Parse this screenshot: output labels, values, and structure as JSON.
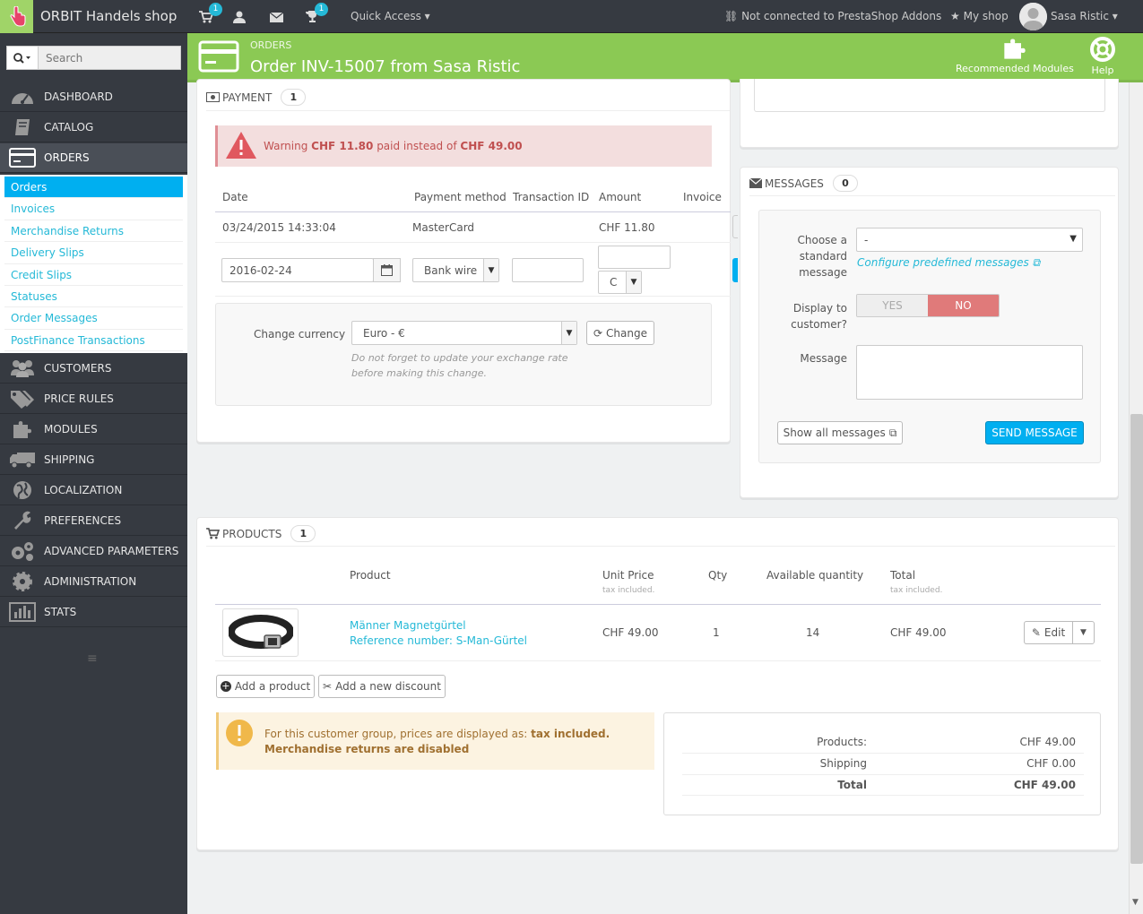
{
  "topbar": {
    "shop_name": "ORBIT Handels shop",
    "cart_badge": "1",
    "trophy_badge": "1",
    "quick_access": "Quick Access",
    "addons_status": "Not connected to PrestaShop Addons",
    "my_shop": "My shop",
    "user_name": "Sasa Ristic"
  },
  "sidebar": {
    "search_placeholder": "Search",
    "menu": [
      {
        "label": "DASHBOARD"
      },
      {
        "label": "CATALOG"
      },
      {
        "label": "ORDERS"
      },
      {
        "label": "CUSTOMERS"
      },
      {
        "label": "PRICE RULES"
      },
      {
        "label": "MODULES"
      },
      {
        "label": "SHIPPING"
      },
      {
        "label": "LOCALIZATION"
      },
      {
        "label": "PREFERENCES"
      },
      {
        "label": "ADVANCED PARAMETERS"
      },
      {
        "label": "ADMINISTRATION"
      },
      {
        "label": "STATS"
      }
    ],
    "submenu": [
      {
        "label": "Orders"
      },
      {
        "label": "Invoices"
      },
      {
        "label": "Merchandise Returns"
      },
      {
        "label": "Delivery Slips"
      },
      {
        "label": "Credit Slips"
      },
      {
        "label": "Statuses"
      },
      {
        "label": "Order Messages"
      },
      {
        "label": "PostFinance Transactions"
      }
    ]
  },
  "header": {
    "breadcrumb": "ORDERS",
    "title": "Order INV-15007 from Sasa Ristic",
    "recommended_modules": "Recommended Modules",
    "help": "Help"
  },
  "payment": {
    "heading": "PAYMENT",
    "count": "1",
    "warning_prefix": "Warning",
    "warning_paid": "CHF 11.80",
    "warning_mid": "paid instead of",
    "warning_expected": "CHF 49.00",
    "columns": {
      "date": "Date",
      "method": "Payment method",
      "transaction": "Transaction ID",
      "amount": "Amount",
      "invoice": "Invoice"
    },
    "row": {
      "date": "03/24/2015 14:33:04",
      "method": "MasterCard",
      "amount": "CHF 11.80"
    },
    "form": {
      "date_value": "2016-02-24",
      "method_value": "Bank wire",
      "currency_short": "C"
    },
    "currency": {
      "label": "Change currency",
      "value": "Euro - €",
      "button": "Change",
      "note": "Do not forget to update your exchange rate before making this change."
    }
  },
  "messages": {
    "heading": "MESSAGES",
    "count": "0",
    "choose_label_1": "Choose a",
    "choose_label_2": "standard",
    "choose_label_3": "message",
    "choose_value": "-",
    "configure_link": "Configure predefined messages",
    "display_label_1": "Display to",
    "display_label_2": "customer?",
    "yes": "YES",
    "no": "NO",
    "message_label": "Message",
    "show_all": "Show all messages",
    "send": "SEND MESSAGE"
  },
  "products": {
    "heading": "PRODUCTS",
    "count": "1",
    "columns": {
      "product": "Product",
      "unit_price": "Unit Price",
      "unit_price_sub": "tax included.",
      "qty": "Qty",
      "available": "Available quantity",
      "total": "Total",
      "total_sub": "tax included."
    },
    "row": {
      "name": "Männer Magnetgürtel",
      "reference": "Reference number: S-Man-Gürtel",
      "unit_price": "CHF 49.00",
      "qty": "1",
      "available": "14",
      "total": "CHF 49.00",
      "edit": "Edit"
    },
    "add_product": "Add a product",
    "add_discount": "Add a new discount",
    "notice_prefix": "For this customer group, prices are displayed as:",
    "notice_bold": "tax included.",
    "notice_returns": "Merchandise returns are disabled",
    "summary": {
      "products_label": "Products:",
      "products_value": "CHF 49.00",
      "shipping_label": "Shipping",
      "shipping_value": "CHF 0.00",
      "total_label": "Total",
      "total_value": "CHF 49.00"
    }
  },
  "colors": {
    "header_green": "#8bc954",
    "sidebar_dark": "#363a41",
    "primary_blue": "#00aff0",
    "link_blue": "#25b9d7"
  }
}
